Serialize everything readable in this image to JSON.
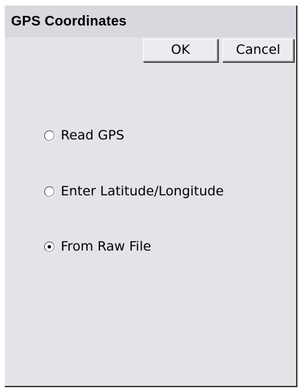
{
  "dialog": {
    "title": "GPS Coordinates",
    "ok_label": "OK",
    "cancel_label": "Cancel"
  },
  "options": [
    {
      "label": "Read GPS",
      "checked": false
    },
    {
      "label": "Enter Latitude/Longitude",
      "checked": false
    },
    {
      "label": "From Raw File",
      "checked": true
    }
  ],
  "colors": {
    "dialog_bg": "#e4e3e8",
    "titlebar_bg": "#d9d8de"
  }
}
